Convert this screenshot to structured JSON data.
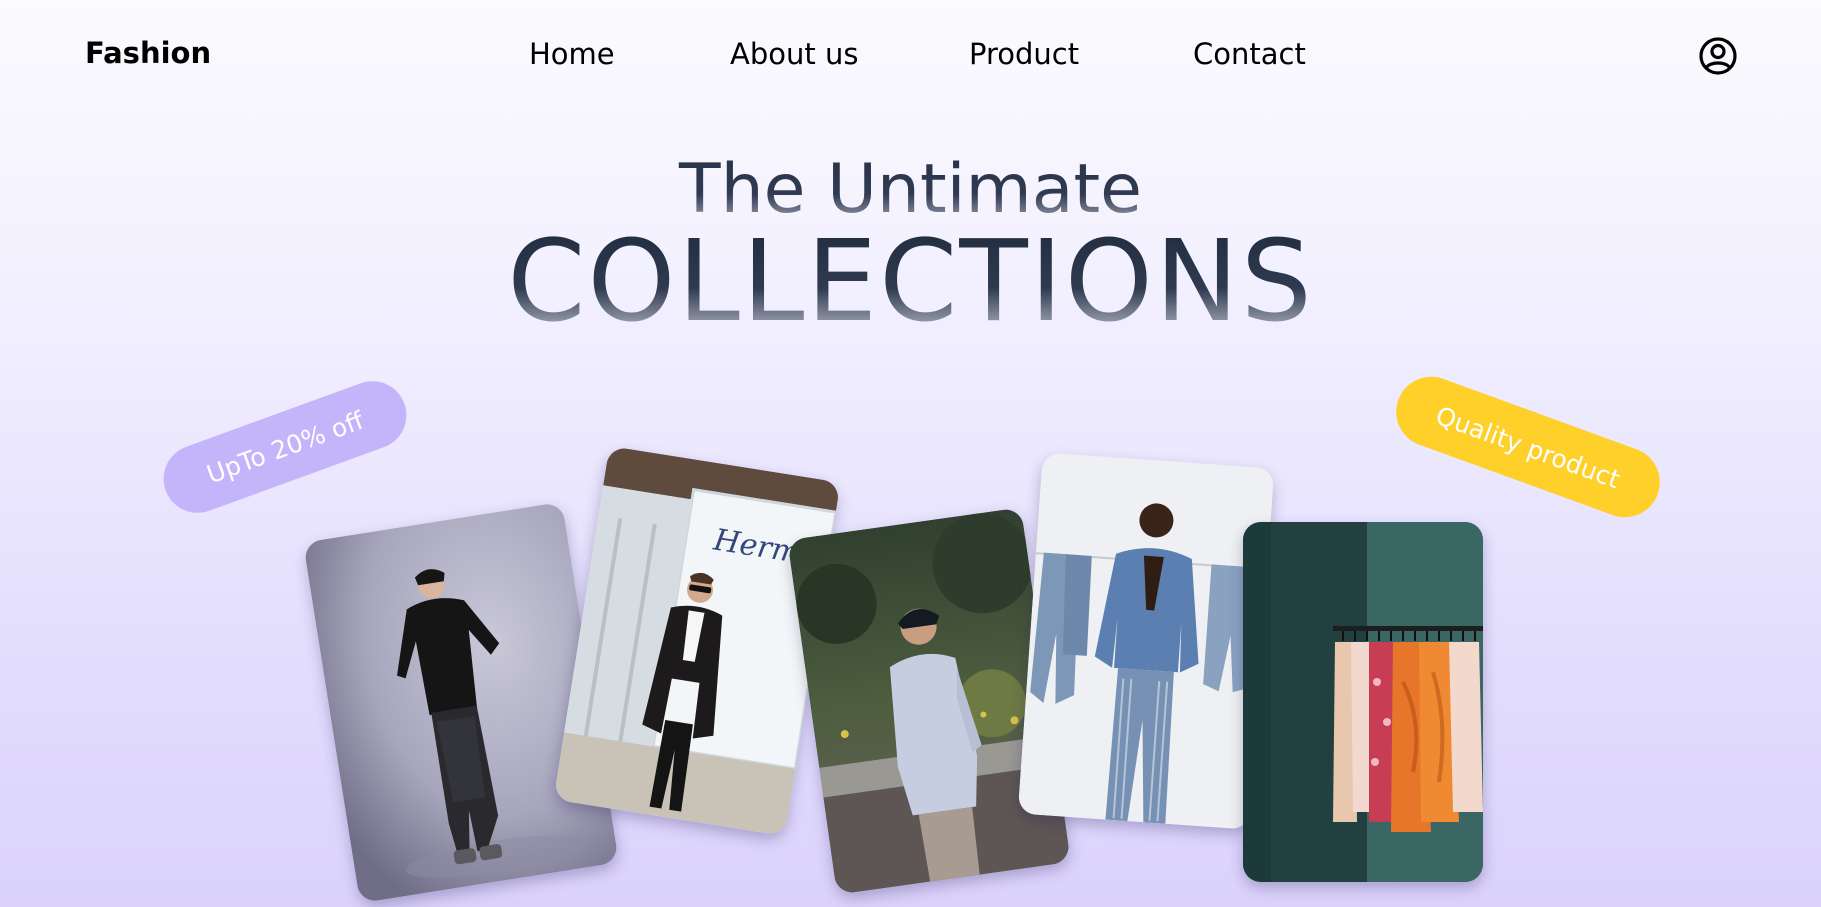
{
  "header": {
    "brand": "Fashion",
    "nav": [
      "Home",
      "About us",
      "Product",
      "Contact"
    ],
    "account_icon": "user-circle-icon"
  },
  "hero": {
    "subtitle": "The Untimate",
    "title": "COLLECTIONS"
  },
  "badges": {
    "discount": "UpTo 20% off",
    "quality": "Quality product"
  },
  "colors": {
    "discount_badge": "#c4b5fb",
    "quality_badge": "#ffcf2a",
    "text_dark": "#273247"
  },
  "gallery": {
    "images": [
      "man-black-outfit-photo",
      "man-trench-coat-photo",
      "boy-sweatshirt-photo",
      "man-denim-photo",
      "clothing-rack-photo"
    ]
  }
}
